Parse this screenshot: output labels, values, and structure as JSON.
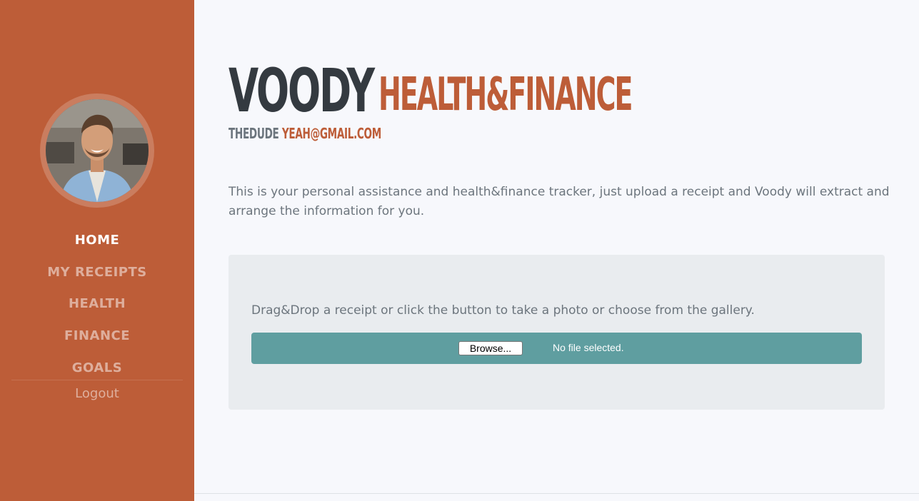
{
  "sidebar": {
    "avatar_alt": "profile photo",
    "nav": [
      {
        "label": "HOME",
        "active": true
      },
      {
        "label": "MY RECEIPTS",
        "active": false
      },
      {
        "label": "HEALTH",
        "active": false
      },
      {
        "label": "FINANCE",
        "active": false
      },
      {
        "label": "GOALS",
        "active": false
      }
    ],
    "logout_label": "Logout"
  },
  "header": {
    "title_first": "VOODY",
    "title_last": "HEALTH&FINANCE",
    "user_name": "THEDUDE",
    "user_email": "YEAH@GMAIL.COM"
  },
  "intro": "This is your personal assistance and health&finance tracker, just upload a receipt and Voody will extract and arrange the information for you.",
  "upload": {
    "instruction": "Drag&Drop a receipt or click the button to take a photo or choose from the gallery.",
    "browse_label": "Browse...",
    "file_status": "No file selected."
  },
  "colors": {
    "primary": "#bd5d38",
    "dark": "#343a40",
    "muted": "#6c757d",
    "file_bar": "#5f9ea0",
    "upload_bg": "#e9ecef"
  }
}
